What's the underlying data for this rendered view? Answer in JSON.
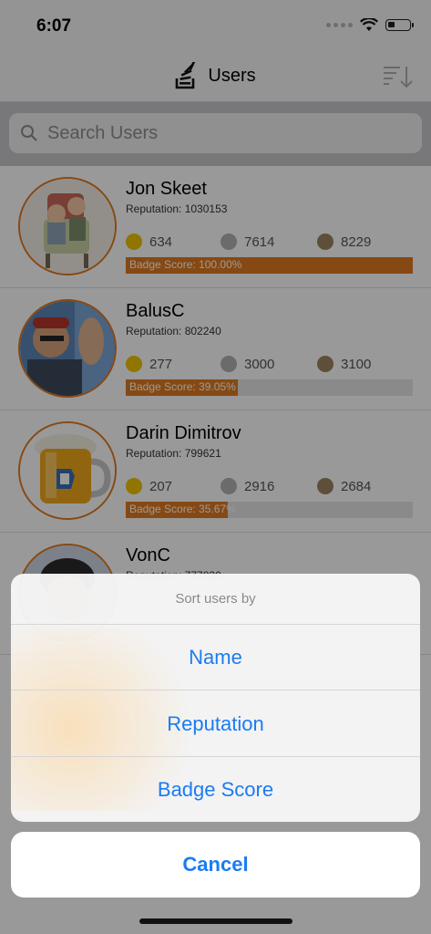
{
  "status_bar": {
    "time": "6:07"
  },
  "nav": {
    "title": "Users",
    "sort_icon": "sort-descending-icon"
  },
  "search": {
    "placeholder": "Search Users"
  },
  "users": [
    {
      "name": "Jon Skeet",
      "reputation": "Reputation: 1030153",
      "gold": "634",
      "silver": "7614",
      "bronze": "8229",
      "badge_score": "Badge Score: 100.00%",
      "score_fraction": 1.0
    },
    {
      "name": "BalusC",
      "reputation": "Reputation: 802240",
      "gold": "277",
      "silver": "3000",
      "bronze": "3100",
      "badge_score": "Badge Score: 39.05%",
      "score_fraction": 0.3905
    },
    {
      "name": "Darin Dimitrov",
      "reputation": "Reputation: 799621",
      "gold": "207",
      "silver": "2916",
      "bronze": "2684",
      "badge_score": "Badge Score: 35.67%",
      "score_fraction": 0.3567
    },
    {
      "name": "VonC",
      "reputation": "Reputation: 777830"
    }
  ],
  "action_sheet": {
    "title": "Sort users by",
    "options": [
      "Name",
      "Reputation",
      "Badge Score"
    ],
    "cancel": "Cancel"
  },
  "colors": {
    "accent": "#e07b20",
    "link": "#1a7cf2",
    "gold": "#f0c400",
    "silver": "#b2b2b2",
    "bronze": "#9c8460"
  }
}
